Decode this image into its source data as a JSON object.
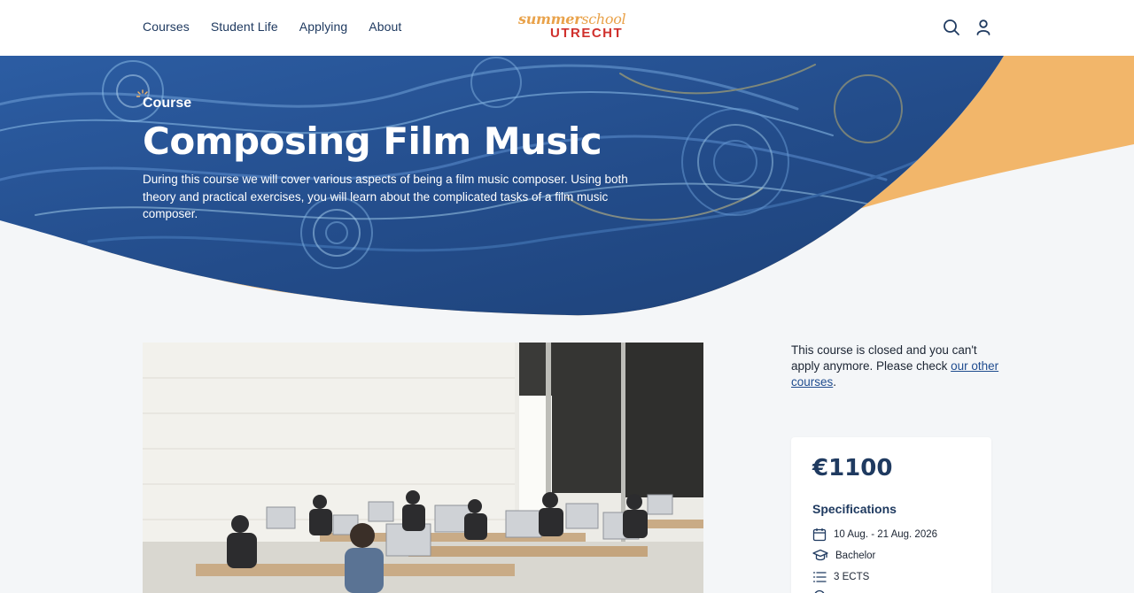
{
  "header": {
    "nav": [
      "Courses",
      "Student Life",
      "Applying",
      "About"
    ],
    "logo_line1_a": "summer",
    "logo_line1_b": "school",
    "logo_line2": "UTRECHT",
    "icons": [
      "search-icon",
      "user-icon"
    ]
  },
  "hero": {
    "kicker": "Course",
    "title": "Composing Film Music",
    "description": "During this course we will cover various aspects of being a film music composer. Using both theory and practical exercises, you will learn about the complicated tasks of a film music composer."
  },
  "sidebar": {
    "closed_text": "This course is closed and you can't apply anymore. Please check ",
    "closed_link": "our other courses",
    "closed_end": "."
  },
  "card": {
    "price": "€1100",
    "spec_title": "Specifications",
    "specs": [
      {
        "icon": "calendar-icon",
        "text": "10 Aug. - 21 Aug. 2026"
      },
      {
        "icon": "graduation-cap-icon",
        "text": "Bachelor"
      },
      {
        "icon": "list-icon",
        "text": "3 ECTS"
      }
    ]
  },
  "colors": {
    "navy": "#1f3a60",
    "accent_orange": "#f2b66a",
    "logo_red": "#d0312d",
    "hero_blue": "#26508f"
  }
}
